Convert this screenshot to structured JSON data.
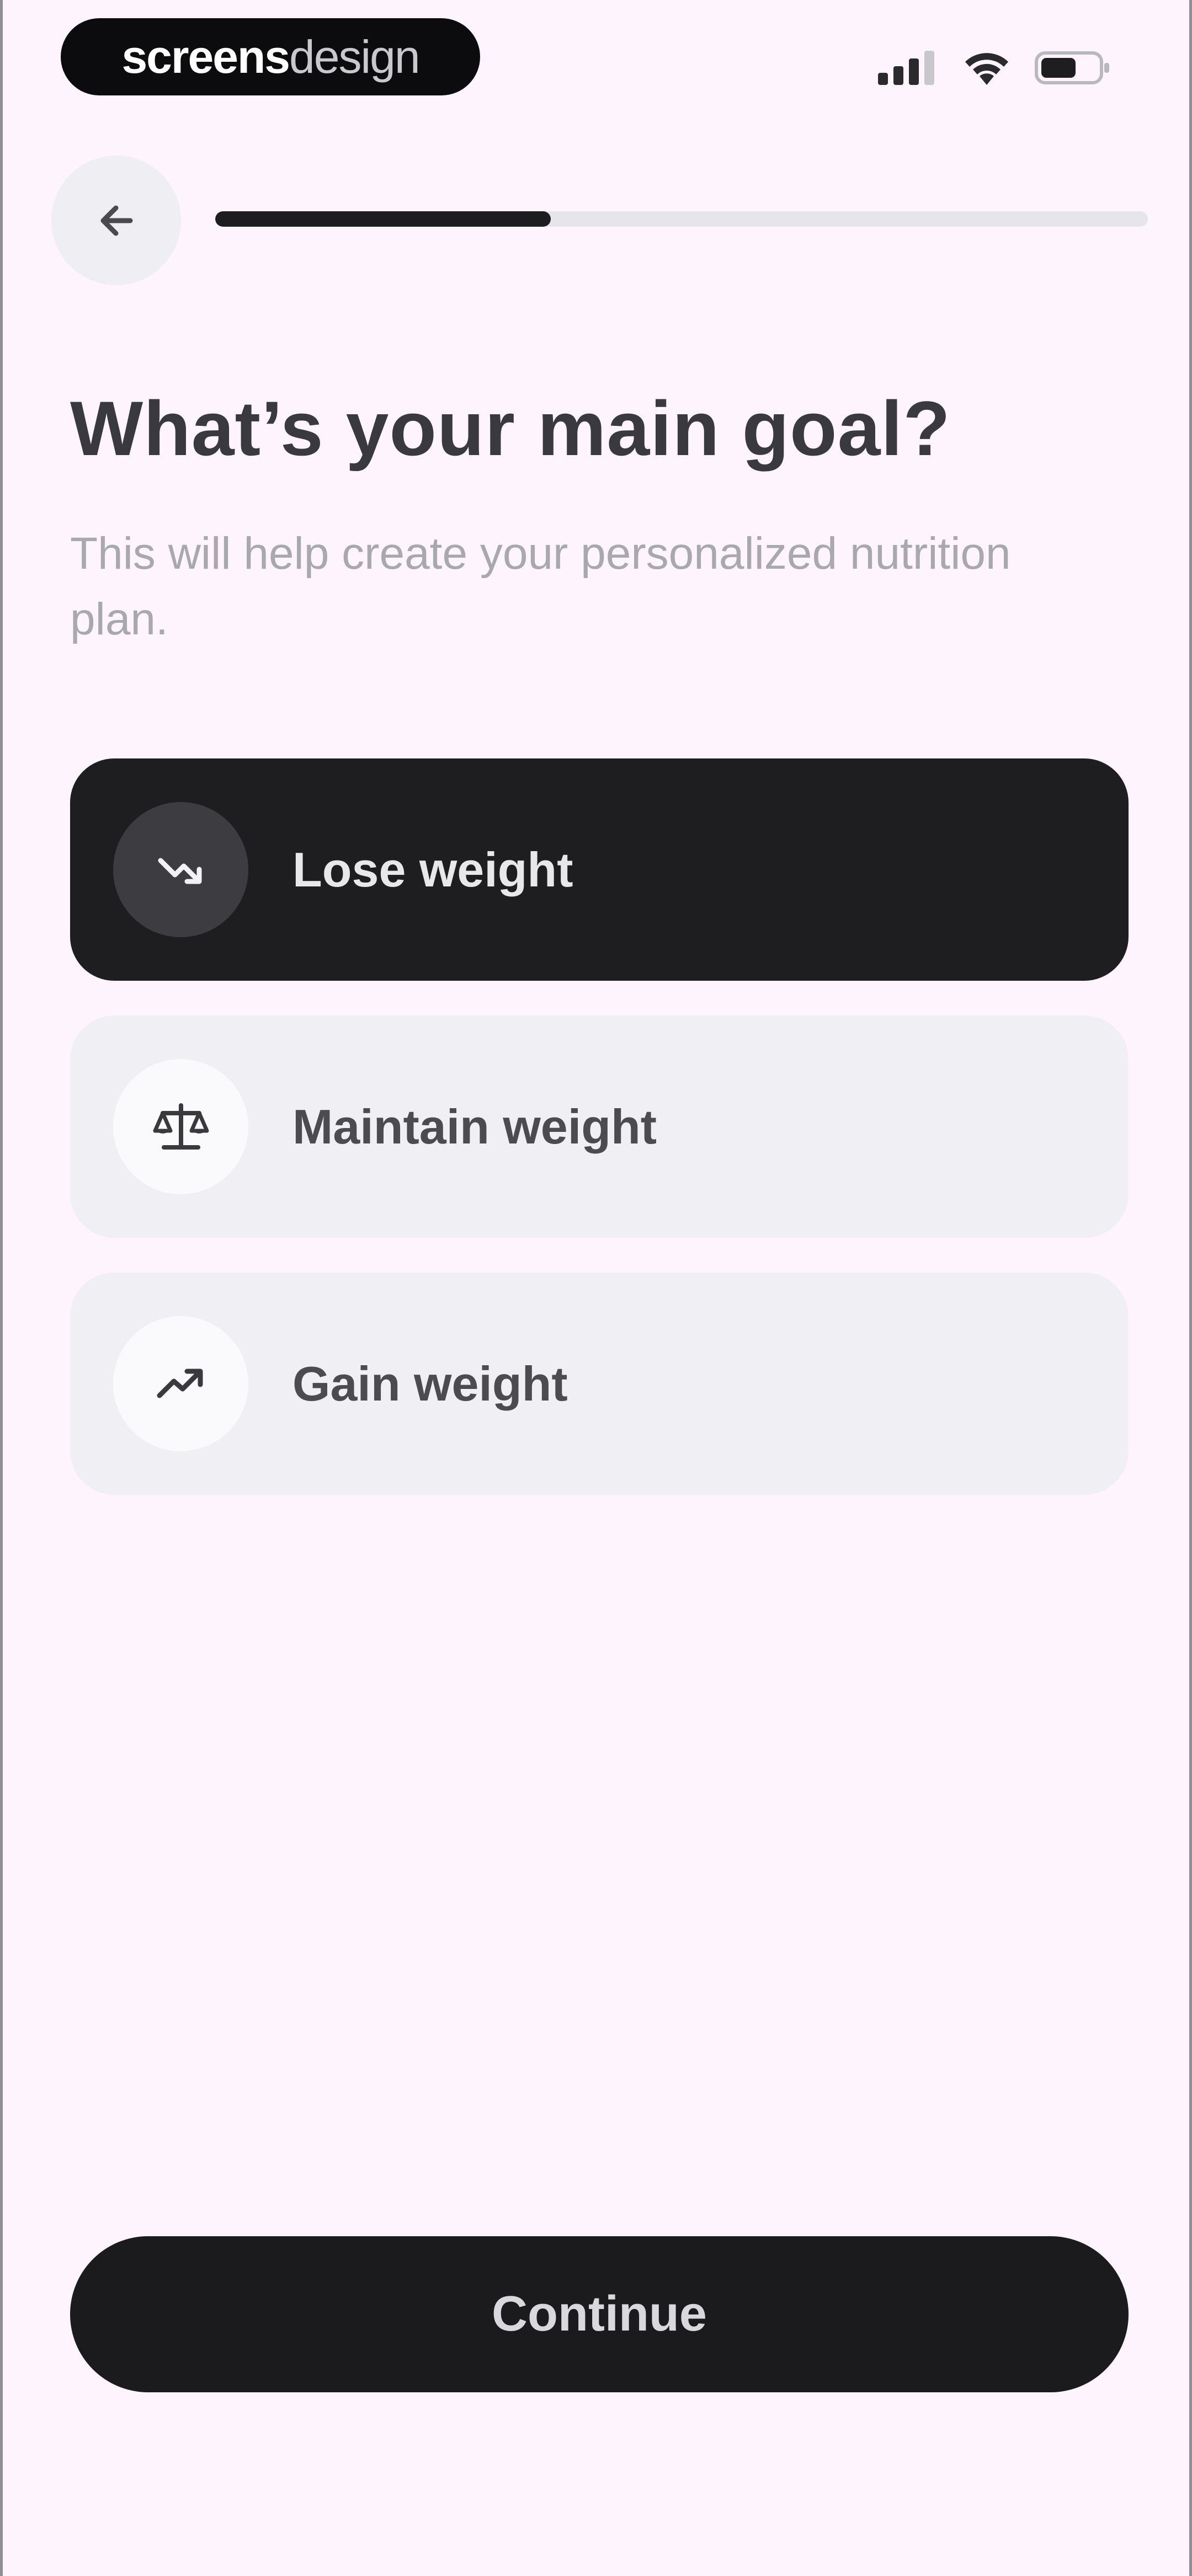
{
  "status_bar": {
    "brand_part1": "screens",
    "brand_part2": "design",
    "icons": [
      "cellular-signal-icon",
      "wifi-icon",
      "battery-icon"
    ]
  },
  "header": {
    "back_icon": "arrow-left-icon",
    "progress_fraction": 0.36
  },
  "title": "What’s your main goal?",
  "subtitle": "This will help create your personalized nutrition plan.",
  "options": [
    {
      "label": "Lose weight",
      "icon": "trending-down-icon",
      "selected": true
    },
    {
      "label": "Maintain weight",
      "icon": "scale-icon",
      "selected": false
    },
    {
      "label": "Gain weight",
      "icon": "trending-up-icon",
      "selected": false
    }
  ],
  "continue_label": "Continue",
  "colors": {
    "background": "#fdf4fd",
    "selected_card": "#1e1e20",
    "card": "#f0eff3",
    "primary_button": "#1b1b1d",
    "progress_fill": "#1d1d1f",
    "progress_track": "#e6e5ea"
  }
}
